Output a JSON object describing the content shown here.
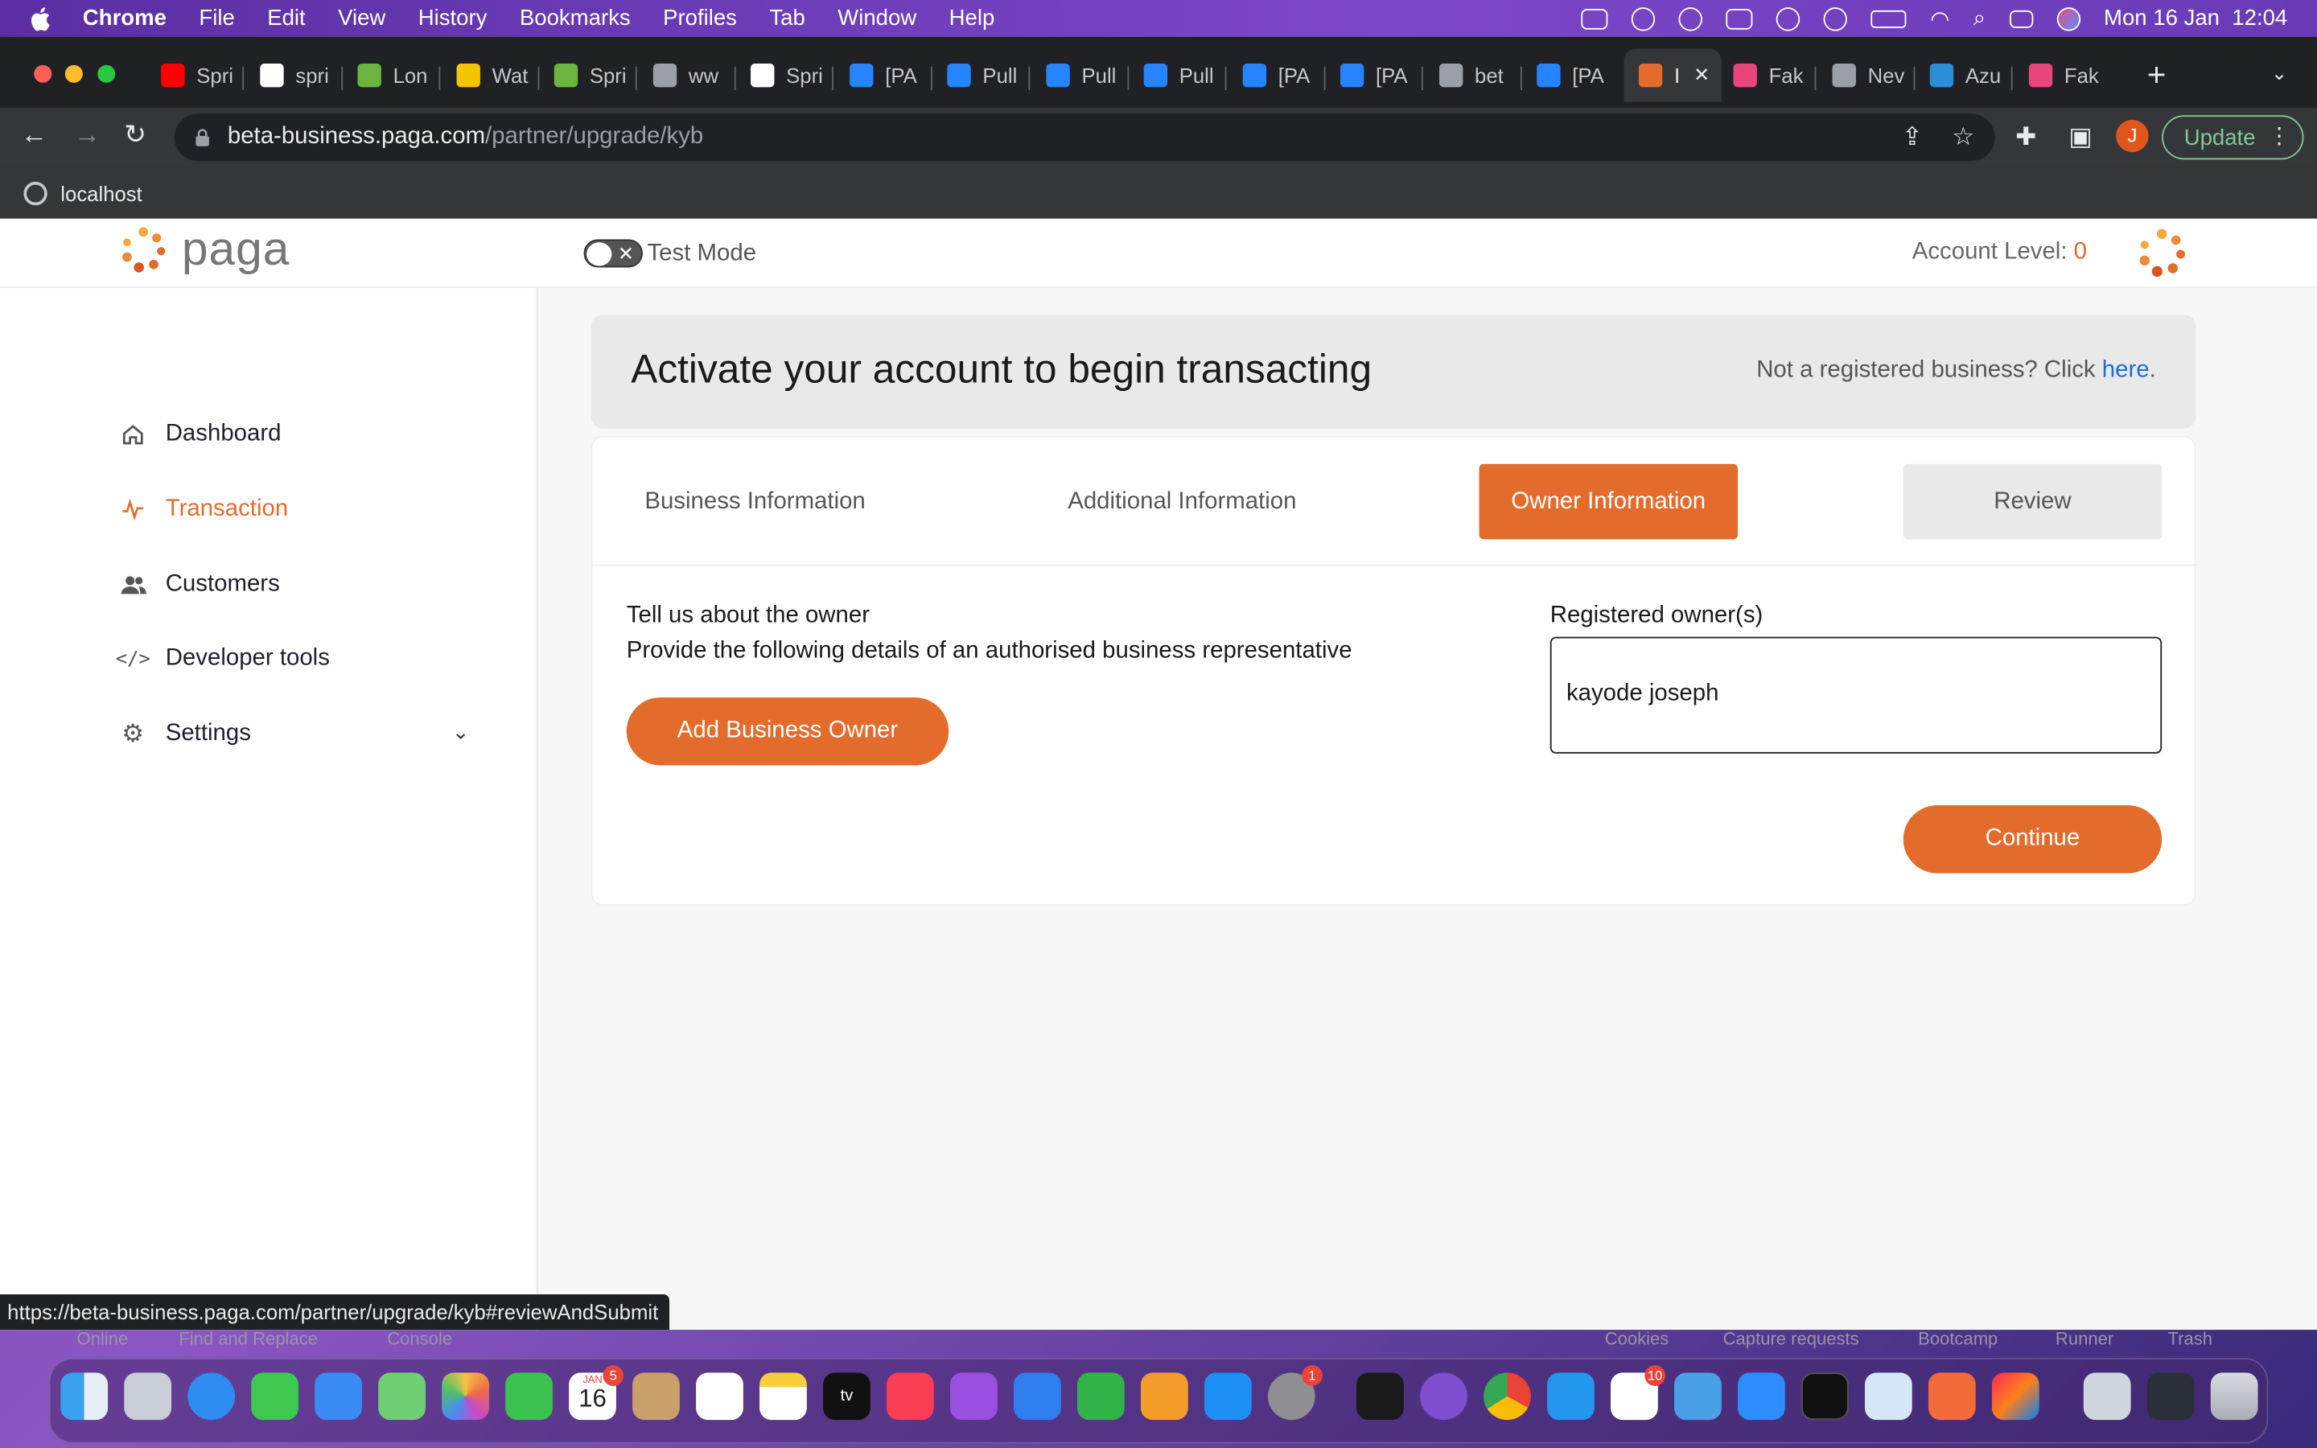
{
  "menubar": {
    "app": "Chrome",
    "items": [
      "File",
      "Edit",
      "View",
      "History",
      "Bookmarks",
      "Profiles",
      "Tab",
      "Window",
      "Help"
    ],
    "datetime": "Mon 16 Jan  12:04"
  },
  "tabs": [
    {
      "label": "Spri",
      "color": "#ff0000"
    },
    {
      "label": "spri",
      "color": "#ffffff"
    },
    {
      "label": "Lon",
      "color": "#6cb33f"
    },
    {
      "label": "Wat",
      "color": "#f5c400"
    },
    {
      "label": "Spri",
      "color": "#6cb33f"
    },
    {
      "label": "ww",
      "color": "#9aa0a6"
    },
    {
      "label": "Spri",
      "color": "#ffffff"
    },
    {
      "label": "[PA",
      "color": "#2684ff"
    },
    {
      "label": "Pull",
      "color": "#2684ff"
    },
    {
      "label": "Pull",
      "color": "#2684ff"
    },
    {
      "label": "Pull",
      "color": "#2684ff"
    },
    {
      "label": "[PA",
      "color": "#2684ff"
    },
    {
      "label": "[PA",
      "color": "#2684ff"
    },
    {
      "label": "bet",
      "color": "#9aa0a6"
    },
    {
      "label": "[PA",
      "color": "#2684ff"
    },
    {
      "label": "I",
      "color": "#e36b2c",
      "active": true
    },
    {
      "label": "Fak",
      "color": "#e8457c"
    },
    {
      "label": "Nev",
      "color": "#9aa0a6"
    },
    {
      "label": "Azu",
      "color": "#2a8fd8"
    },
    {
      "label": "Fak",
      "color": "#e8457c"
    }
  ],
  "address": {
    "host": "beta-business.paga.com",
    "path": "/partner/upgrade/kyb"
  },
  "toolbar": {
    "profile_initial": "J",
    "update_label": "Update"
  },
  "bookmarks": {
    "item": "localhost"
  },
  "app": {
    "logo_text": "paga",
    "test_mode": "Test Mode",
    "account_level_label": "Account Level: ",
    "account_level_value": "0",
    "brand_color": "#e36b2c"
  },
  "sidebar": {
    "items": [
      {
        "label": "Dashboard",
        "icon": "home-icon"
      },
      {
        "label": "Transaction",
        "icon": "activity-icon",
        "active": true
      },
      {
        "label": "Customers",
        "icon": "users-icon"
      },
      {
        "label": "Developer tools",
        "icon": "code-icon"
      },
      {
        "label": "Settings",
        "icon": "gear-icon"
      }
    ]
  },
  "banner": {
    "title": "Activate your account to begin transacting",
    "not_registered": "Not a registered business? Click ",
    "here": "here",
    "period": "."
  },
  "steps": [
    "Business Information",
    "Additional Information",
    "Owner Information",
    "Review"
  ],
  "owner": {
    "title": "Tell us about the owner",
    "subtitle": "Provide the following details of an authorised business representative",
    "add_button": "Add Business Owner",
    "registered_label": "Registered owner(s)",
    "registered_value": "kayode joseph",
    "continue_button": "Continue"
  },
  "status_url": "https://beta-business.paga.com/partner/upgrade/kyb#reviewAndSubmit",
  "peek": {
    "left": [
      "Online",
      "Find and Replace",
      "Console"
    ],
    "right": [
      "Cookies",
      "Capture requests",
      "Bootcamp",
      "Runner",
      "Trash"
    ]
  },
  "dock": {
    "calendar_month": "JAN",
    "calendar_day": "16",
    "badges": {
      "calendar": "5",
      "settings": "1",
      "slack": "10"
    }
  }
}
